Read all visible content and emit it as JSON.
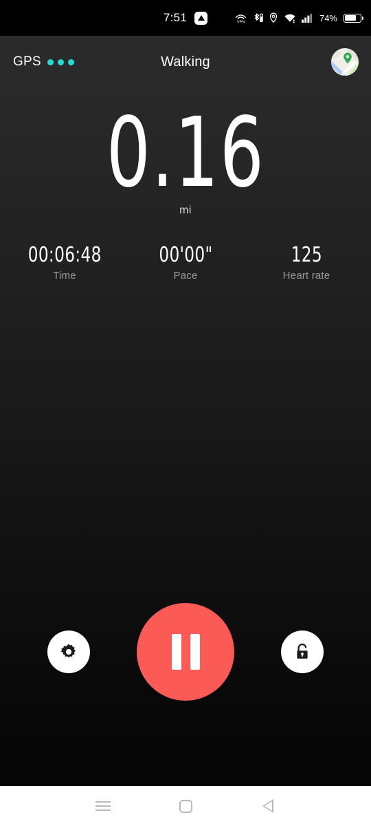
{
  "status_bar": {
    "time": "7:51",
    "notification_icon": "triangle-up-badge-icon",
    "icons": [
      "vpn-icon",
      "bluetooth-battery-icon",
      "location-pin-icon",
      "wifi-icon",
      "cellular-signal-icon"
    ],
    "battery_percent": "74%",
    "battery_level": 74
  },
  "app_header": {
    "gps_label": "GPS",
    "gps_signal_dots": 3,
    "gps_dot_color": "#21dcd6",
    "activity_title": "Walking",
    "map_button_icon": "map-thumbnail-icon"
  },
  "metrics": {
    "distance_value": "0.16",
    "distance_unit": "mi",
    "stats": [
      {
        "value": "00:06:48",
        "label": "Time"
      },
      {
        "value": "00'00\"",
        "label": "Pace"
      },
      {
        "value": "125",
        "label": "Heart rate"
      }
    ]
  },
  "controls": {
    "settings_icon": "gear-icon",
    "pause_icon": "pause-icon",
    "pause_color": "#fb5a55",
    "lock_icon": "unlocked-padlock-icon"
  },
  "nav_bar": {
    "recents_icon": "recents-icon",
    "home_icon": "home-square-icon",
    "back_icon": "back-triangle-icon"
  }
}
